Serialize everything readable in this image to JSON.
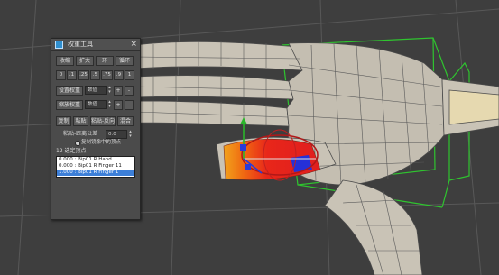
{
  "panel": {
    "title": "权重工具",
    "close_glyph": "×",
    "row1": [
      "收缩",
      "扩大",
      "环",
      "循环"
    ],
    "row2": [
      "0",
      ".1",
      ".25",
      ".5",
      ".75",
      ".9",
      "1"
    ],
    "set_weight": {
      "label": "设置权重",
      "value": "数值",
      "plus": "+",
      "minus": "-"
    },
    "scale_weight": {
      "label": "缩放权重",
      "value": "数值",
      "plus": "+",
      "minus": "-"
    },
    "row3": [
      "复制",
      "粘贴",
      "粘贴-反向",
      "混合"
    ],
    "paste_distance": {
      "label": "粘贴-距离公差",
      "value": "0.0"
    },
    "copy_option": "复制镜像中的顶点",
    "selected_count": "12 选定顶点",
    "bones": [
      {
        "label": "0.000 : Bip01 R Hand",
        "selected": false
      },
      {
        "label": "0.000 : Bip01 R Finger 11",
        "selected": false
      },
      {
        "label": "1.000 : Bip01 R Finger 1",
        "selected": true
      }
    ]
  },
  "viewport": {
    "mesh_color": "#c9c3b6",
    "selection_color": "#e8261a",
    "gizmo_color": "#23a323",
    "bounding_box_color": "#3bd33b"
  }
}
